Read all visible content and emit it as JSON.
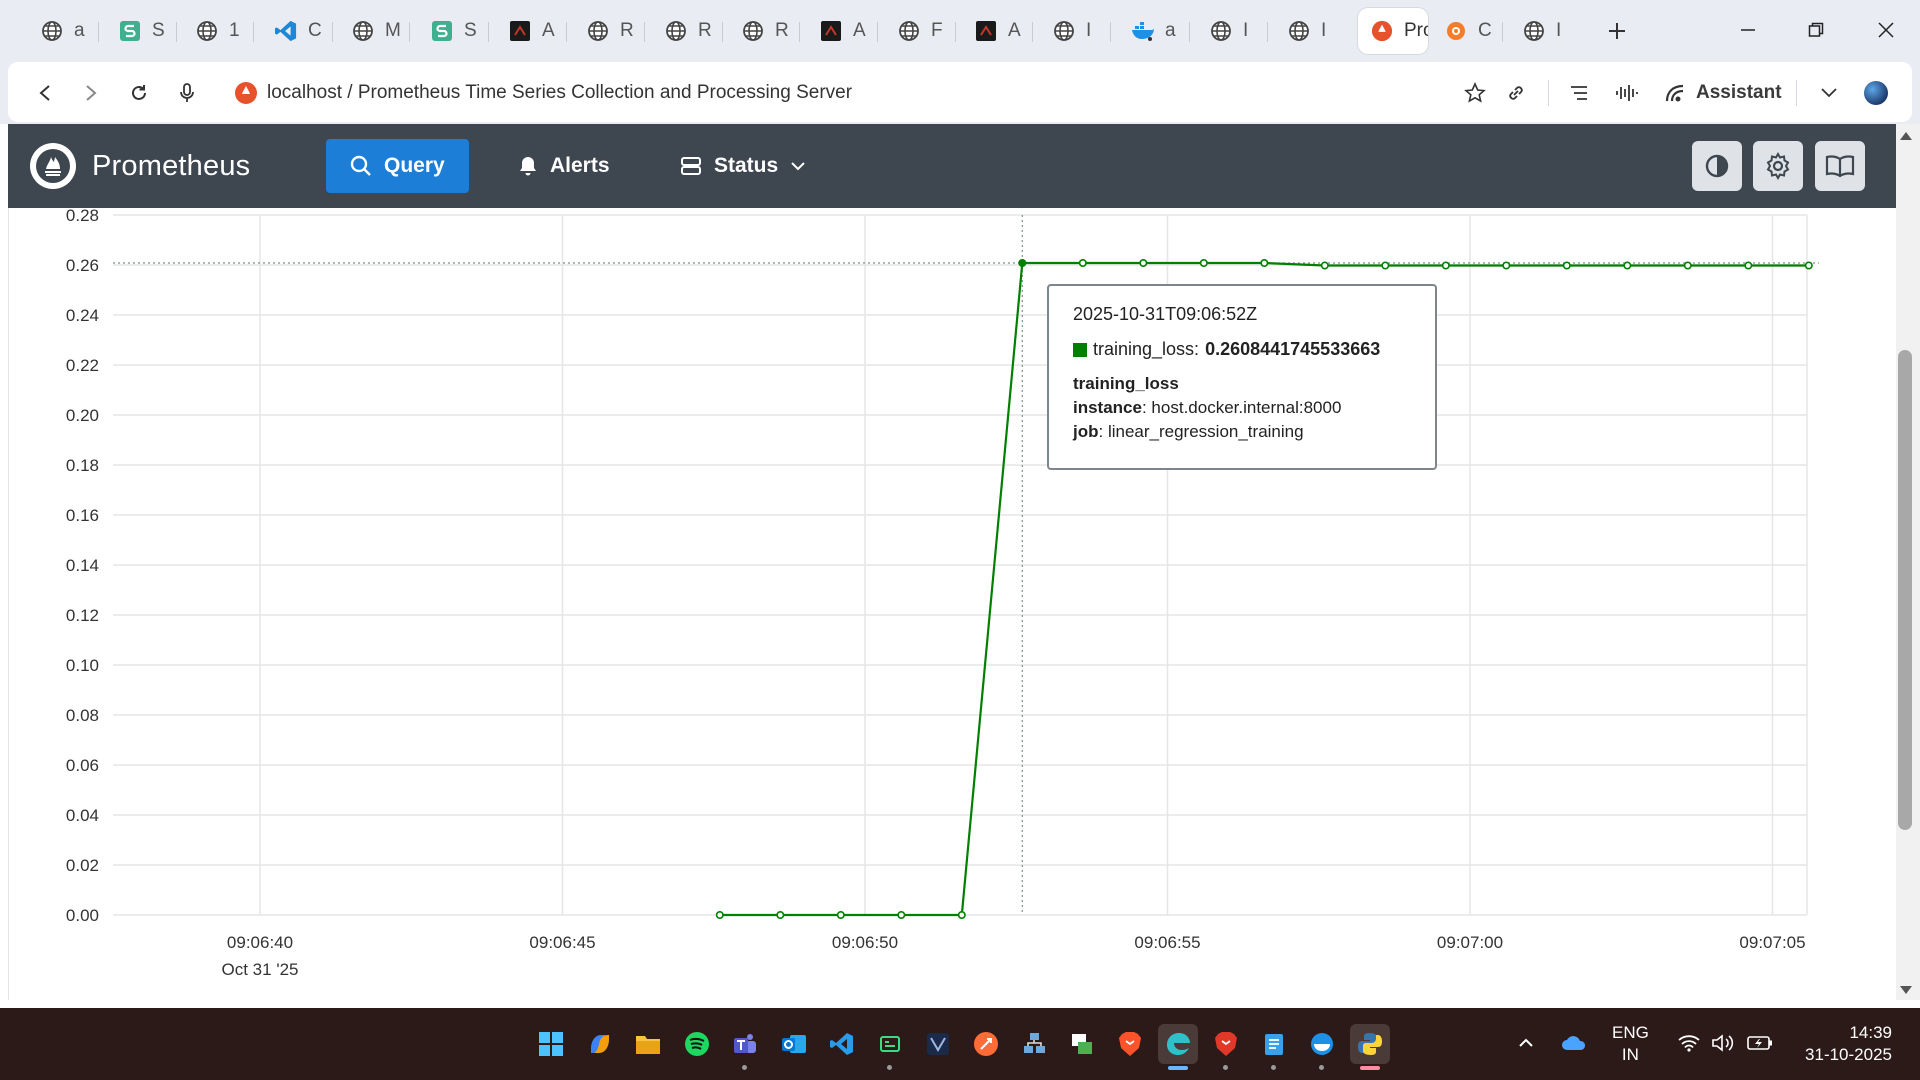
{
  "browser": {
    "tabs": [
      {
        "icon": "globe-icon",
        "title": "a"
      },
      {
        "icon": "s-logo-icon",
        "title": "S"
      },
      {
        "icon": "globe-icon",
        "title": "1"
      },
      {
        "icon": "vscode-icon",
        "title": "C"
      },
      {
        "icon": "globe-icon",
        "title": "M"
      },
      {
        "icon": "s-logo-icon",
        "title": "S"
      },
      {
        "icon": "dark-app-icon",
        "title": "A"
      },
      {
        "icon": "globe-icon",
        "title": "R"
      },
      {
        "icon": "globe-icon",
        "title": "R"
      },
      {
        "icon": "globe-icon",
        "title": "R"
      },
      {
        "icon": "dark-app-icon",
        "title": "A"
      },
      {
        "icon": "globe-icon",
        "title": "F"
      },
      {
        "icon": "dark-app-icon",
        "title": "A"
      },
      {
        "icon": "globe-icon",
        "title": "I"
      },
      {
        "icon": "docker-icon",
        "title": "a"
      },
      {
        "icon": "globe-icon",
        "title": "I"
      },
      {
        "icon": "globe-icon",
        "title": "I"
      },
      {
        "icon": "prometheus-icon",
        "title": "Prom",
        "active": true
      },
      {
        "icon": "grafana-icon",
        "title": "C"
      },
      {
        "icon": "globe-icon",
        "title": "I"
      }
    ],
    "address": "localhost / Prometheus Time Series Collection and Processing Server",
    "assistant_label": "Assistant"
  },
  "prometheus": {
    "title": "Prometheus",
    "nav": {
      "query": "Query",
      "alerts": "Alerts",
      "status": "Status"
    }
  },
  "chart_data": {
    "type": "line",
    "y_ticks": [
      "0.00",
      "0.02",
      "0.04",
      "0.06",
      "0.08",
      "0.10",
      "0.12",
      "0.14",
      "0.16",
      "0.18",
      "0.20",
      "0.22",
      "0.24",
      "0.26",
      "0.28"
    ],
    "ylim": [
      0,
      0.28
    ],
    "x_ticks": [
      {
        "label": "09:06:40",
        "sub": "Oct 31 '25"
      },
      {
        "label": "09:06:45",
        "sub": ""
      },
      {
        "label": "09:06:50",
        "sub": ""
      },
      {
        "label": "09:06:55",
        "sub": ""
      },
      {
        "label": "09:07:00",
        "sub": ""
      },
      {
        "label": "09:07:05",
        "sub": ""
      }
    ],
    "x_tick_seconds": [
      40,
      45,
      50,
      55,
      60,
      65
    ],
    "grid": true,
    "color": "#008000",
    "series": [
      {
        "name": "training_loss",
        "x_seconds": [
          47.6,
          48.6,
          49.6,
          50.6,
          51.6,
          52.6,
          53.6,
          54.6,
          55.6,
          56.6,
          57.6,
          58.6,
          59.6,
          60.6,
          61.6,
          62.6,
          63.6,
          64.6,
          65.6
        ],
        "values": [
          0.0,
          0.0,
          0.0,
          0.0,
          0.0,
          0.2608,
          0.2608,
          0.2608,
          0.2608,
          0.2608,
          0.2598,
          0.2598,
          0.2598,
          0.2598,
          0.2598,
          0.2598,
          0.2598,
          0.2598,
          0.2598
        ]
      }
    ],
    "hover": {
      "x_seconds": 52.6,
      "value": 0.2608
    }
  },
  "tooltip": {
    "timestamp": "2025-10-31T09:06:52Z",
    "series_label": "training_loss:",
    "series_value": "0.2608441745533663",
    "metric": "training_loss",
    "instance_key": "instance",
    "instance_value": ": host.docker.internal:8000",
    "job_key": "job",
    "job_value": ": linear_regression_training"
  },
  "taskbar": {
    "language": "ENG",
    "region": "IN",
    "time": "14:39",
    "date": "31-10-2025"
  }
}
